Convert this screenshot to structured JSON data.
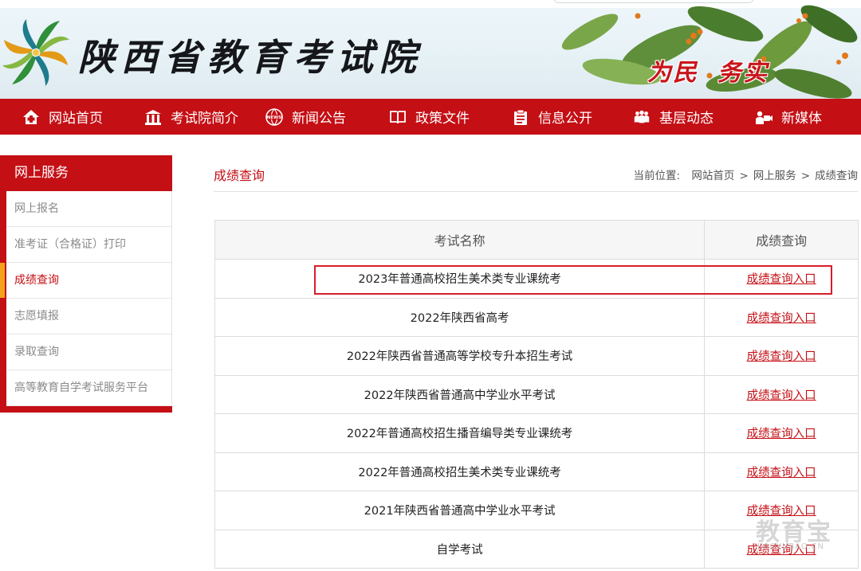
{
  "header": {
    "site_title": "陕西省教育考试院",
    "slogan_left": "为民",
    "slogan_right": "务实"
  },
  "nav": {
    "items": [
      {
        "label": "网站首页",
        "icon": "home-icon"
      },
      {
        "label": "考试院简介",
        "icon": "building-icon"
      },
      {
        "label": "新闻公告",
        "icon": "news-globe-icon"
      },
      {
        "label": "政策文件",
        "icon": "book-icon"
      },
      {
        "label": "信息公开",
        "icon": "clipboard-icon"
      },
      {
        "label": "基层动态",
        "icon": "people-icon"
      },
      {
        "label": "新媒体",
        "icon": "camera-icon"
      }
    ]
  },
  "sidebar": {
    "title": "网上服务",
    "items": [
      {
        "label": "网上报名",
        "active": false
      },
      {
        "label": "准考证（合格证）打印",
        "active": false
      },
      {
        "label": "成绩查询",
        "active": true
      },
      {
        "label": "志愿填报",
        "active": false
      },
      {
        "label": "录取查询",
        "active": false
      },
      {
        "label": "高等教育自学考试服务平台",
        "active": false
      }
    ]
  },
  "main": {
    "page_title": "成绩查询",
    "breadcrumb": {
      "prefix": "当前位置:",
      "items": [
        "网站首页",
        "网上服务",
        "成绩查询"
      ],
      "separator": ">"
    },
    "table": {
      "headers": [
        "考试名称",
        "成绩查询"
      ],
      "rows": [
        {
          "name": "2023年普通高校招生美术类专业课统考",
          "link": "成绩查询入口"
        },
        {
          "name": "2022年陕西省高考",
          "link": "成绩查询入口"
        },
        {
          "name": "2022年陕西省普通高等学校专升本招生考试",
          "link": "成绩查询入口"
        },
        {
          "name": "2022年陕西省普通高中学业水平考试",
          "link": "成绩查询入口"
        },
        {
          "name": "2022年普通高校招生播音编导类专业课统考",
          "link": "成绩查询入口"
        },
        {
          "name": "2022年普通高校招生美术类专业课统考",
          "link": "成绩查询入口"
        },
        {
          "name": "2021年陕西省普通高中学业水平考试",
          "link": "成绩查询入口"
        },
        {
          "name": "自学考试",
          "link": "成绩查询入口"
        }
      ]
    }
  },
  "watermark": {
    "text": "教育宝",
    "subtext": "JIAOYUBAO.CN"
  },
  "colors": {
    "brand_red": "#c40f15",
    "highlight_red": "#d81d2a",
    "active_marker": "#f3a21b"
  }
}
